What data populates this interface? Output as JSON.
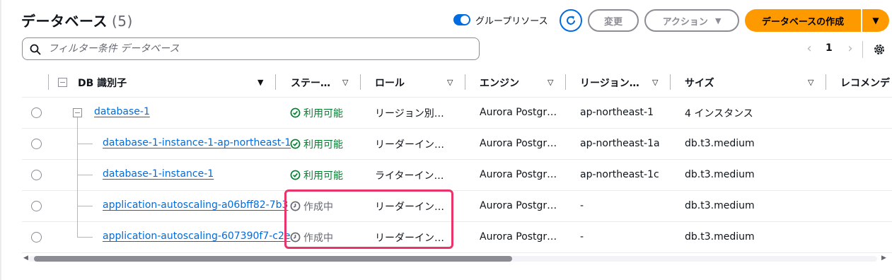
{
  "header": {
    "title": "データベース",
    "count": "(5)",
    "group_toggle_label": "グループリソース",
    "change_label": "変更",
    "action_label": "アクション",
    "create_label": "データベースの作成"
  },
  "search": {
    "placeholder": "フィルター条件 データベース",
    "value": ""
  },
  "pagination": {
    "current_page": "1"
  },
  "table": {
    "columns": [
      {
        "label": "DB 識別子"
      },
      {
        "label": "ステー…"
      },
      {
        "label": "ロール"
      },
      {
        "label": "エンジン"
      },
      {
        "label": "リージョン…"
      },
      {
        "label": "サイズ"
      },
      {
        "label": "レコメンデ"
      }
    ],
    "rows": [
      {
        "id": "database-1",
        "status": "利用可能",
        "status_kind": "available",
        "role": "リージョン別…",
        "engine": "Aurora Postgr…",
        "region": "ap-northeast-1",
        "size": "4 インスタンス"
      },
      {
        "id": "database-1-instance-1-ap-northeast-1",
        "status": "利用可能",
        "status_kind": "available",
        "role": "リーダーイン…",
        "engine": "Aurora Postgr…",
        "region": "ap-northeast-1a",
        "size": "db.t3.medium"
      },
      {
        "id": "database-1-instance-1",
        "status": "利用可能",
        "status_kind": "available",
        "role": "ライターイン…",
        "engine": "Aurora Postgr…",
        "region": "ap-northeast-1c",
        "size": "db.t3.medium"
      },
      {
        "id": "application-autoscaling-a06bff82-7b3",
        "status": "作成中",
        "status_kind": "creating",
        "role": "リーダーイン…",
        "engine": "Aurora Postgr…",
        "region": "-",
        "size": "db.t3.medium"
      },
      {
        "id": "application-autoscaling-607390f7-c2e",
        "status": "作成中",
        "status_kind": "creating",
        "role": "リーダーイン…",
        "engine": "Aurora Postgr…",
        "region": "-",
        "size": "db.t3.medium"
      }
    ]
  },
  "colors": {
    "accent": "#006ce0",
    "primary_button": "#ff9900",
    "status_available": "#00802f",
    "status_creating": "#656871",
    "highlight": "#e8336b"
  },
  "icons": [
    "refresh-icon",
    "search-icon",
    "settings-icon",
    "chevron-left-icon",
    "chevron-right-icon",
    "check-circle-icon",
    "clock-icon",
    "caret-down-icon"
  ]
}
